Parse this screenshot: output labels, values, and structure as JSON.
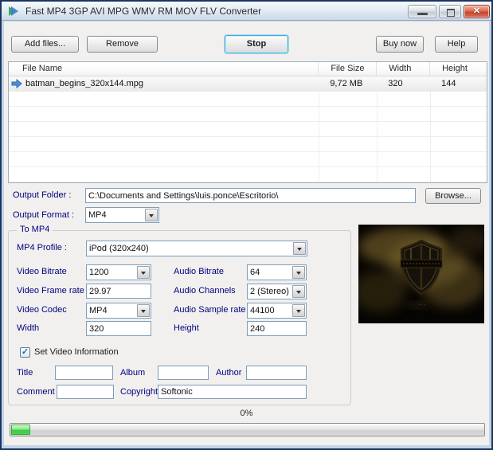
{
  "window": {
    "title": "Fast MP4 3GP AVI MPG WMV RM MOV FLV Converter"
  },
  "icons": {
    "close": "✕",
    "check": "✓"
  },
  "toolbar": {
    "add_files": "Add files...",
    "remove": "Remove",
    "stop": "Stop",
    "buy_now": "Buy now",
    "help": "Help"
  },
  "file_list": {
    "columns": {
      "name": "File Name",
      "size": "File Size",
      "width": "Width",
      "height": "Height"
    },
    "rows": [
      {
        "file_name": "batman_begins_320x144.mpg",
        "file_size": "9,72 MB",
        "width": "320",
        "height": "144"
      }
    ]
  },
  "output": {
    "folder_label": "Output Folder :",
    "folder_value": "C:\\Documents and Settings\\luis.ponce\\Escritorio\\",
    "browse_label": "Browse...",
    "format_label": "Output Format :",
    "format_value": "MP4"
  },
  "profile_group": {
    "title": "To MP4",
    "profile_label": "MP4 Profile :",
    "profile_value": "iPod (320x240)",
    "fields": {
      "video_bitrate": {
        "label": "Video Bitrate",
        "value": "1200"
      },
      "video_frame_rate": {
        "label": "Video Frame rate",
        "value": "29.97"
      },
      "video_codec": {
        "label": "Video Codec",
        "value": "MP4"
      },
      "width": {
        "label": "Width",
        "value": "320"
      },
      "audio_bitrate": {
        "label": "Audio Bitrate",
        "value": "64"
      },
      "audio_channels": {
        "label": "Audio Channels",
        "value": "2 (Stereo)"
      },
      "audio_sample_rate": {
        "label": "Audio Sample rate",
        "value": "44100"
      },
      "height": {
        "label": "Height",
        "value": "240"
      }
    },
    "set_video_info": {
      "label": "Set Video Information",
      "checked": true
    },
    "meta": {
      "title_label": "Title",
      "title_value": "",
      "album_label": "Album",
      "album_value": "",
      "author_label": "Author",
      "author_value": "",
      "comment_label": "Comment",
      "comment_value": "",
      "copyright_label": "Copyright",
      "copyright_value": "Softonic"
    }
  },
  "progress": {
    "percent_label": "0%",
    "value": 4
  },
  "colors": {
    "label_navy": "#000080",
    "stop_highlight": "#49a8d6",
    "progress_green": "#3dcc46",
    "window_border": "#1c3560"
  }
}
